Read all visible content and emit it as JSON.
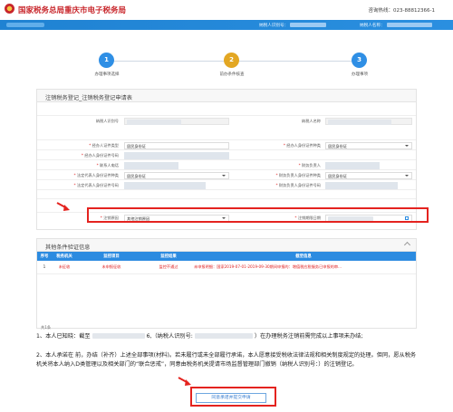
{
  "header": {
    "site_title": "国家税务总局重庆市电子税务局",
    "hotline": "咨询热线：023-88812366-1"
  },
  "topbar": {
    "taxid_label": "纳税人识别号：",
    "name_label": "纳税人名称："
  },
  "steps": [
    {
      "number": "1",
      "label": "办理事项选择",
      "color": "#2f8fe5"
    },
    {
      "number": "2",
      "label": "前办条件核查",
      "color": "#e3a723"
    },
    {
      "number": "3",
      "label": "办理事项",
      "color": "#2f8fe5"
    }
  ],
  "form": {
    "title": "注销税务登记_注销税务登记申请表",
    "taxpayer_id_label": "纳税人识别号",
    "taxpayer_name_label": "纳税人名称",
    "agent_id_type_label": "经办人证件类型",
    "agent_id_type_value": "居民身份证",
    "agent_cert_type_label": "经办人身份证件种类",
    "agent_cert_type_value": "居民身份证",
    "agent_id_number_label": "经办人身份证件号码",
    "agent_phone_label": "联系人电话",
    "legal_phone_label": "联系电话（法人）",
    "legal_rep_label": "财务负责人",
    "legal_cert_type_label": "法定代表人身份证件种类",
    "legal_cert_type_value": "居民身份证",
    "fin_cert_type_label": "财务负责人身份证件种类",
    "fin_cert_type_value": "居民身份证",
    "legal_id_number_label": "法定代表人身份证件号码",
    "fin_id_number_label": "财务负责人身份证件号码",
    "reason_label": "注销原因",
    "reason_value": "其他注销原因",
    "date_label": "注销期限日期"
  },
  "check": {
    "title": "其他条件验证信息",
    "headers": [
      "序号",
      "税务机关",
      "监控项目",
      "监控结果",
      "截至信息"
    ],
    "rows": [
      {
        "index": "1",
        "authority": "未征收",
        "item": "未申报征收",
        "result": "监控不通过",
        "info": "未申报明细：国家2019-07-01-2019-09-30期间申报的：增值税应税服务已申报的审..."
      }
    ],
    "footer": "共1条"
  },
  "statement": {
    "p1_start": "1、本人已知晓：截至",
    "p1_mid": "6,（纳税人识别号:",
    "p1_end": "）在办理税务注销前需完成以上事项未办结;",
    "p2": "2、本人承诺在 前，办结（补齐）上述全部事项(材料)。若未履行或未全部履行承诺，本人愿意接受税收法律法规和相关制度规定的处理。但同，愿从税务机关将本人纳入D类管理以及相关部门的“联合惩戒”，同意由税务机关提请市场监督管理部门撤销（纳税人识别号：）的注销登记。"
  },
  "submit_label": "同意承诺并提交申请"
}
